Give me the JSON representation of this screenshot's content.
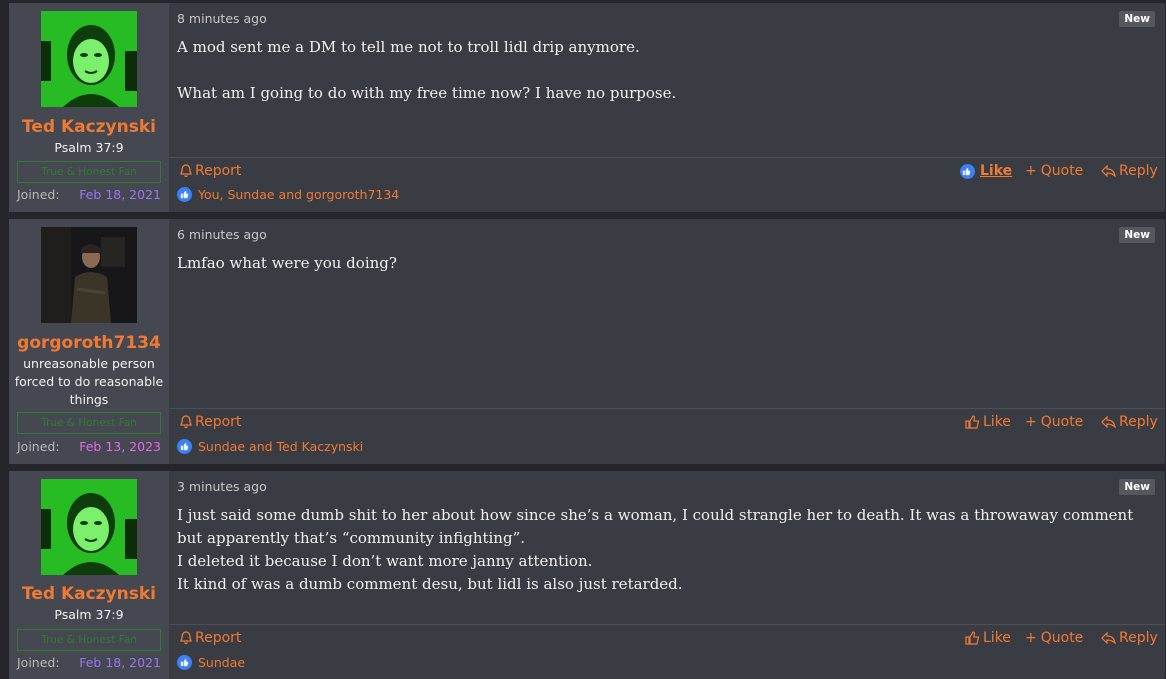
{
  "colors": {
    "accent": "#f07a32",
    "banner": "#2f7d32",
    "joined_date": "#9b74f5",
    "joined_date_alt": "#e06ce6",
    "reaction_icon": "#3b82f6"
  },
  "labels": {
    "new": "New",
    "report": "Report",
    "like": "Like",
    "quote": "Quote",
    "reply": "Reply",
    "joined": "Joined:"
  },
  "posts": [
    {
      "author": "Ted Kaczynski",
      "user_title": "Psalm 37:9",
      "banner": "True & Honest Fan",
      "joined_date": "Feb 18, 2021",
      "time": "8 minutes ago",
      "paragraphs": [
        "A mod sent me a DM to tell me not to troll lidl drip anymore.",
        "What am I going to do with my free time now? I have no purpose."
      ],
      "liked_by_you": true,
      "reactions": "You, Sundae and gorgoroth7134"
    },
    {
      "author": "gorgoroth7134",
      "user_title": "unreasonable person forced to do reasonable things",
      "banner": "True & Honest Fan",
      "joined_date": "Feb 13, 2023",
      "time": "6 minutes ago",
      "paragraphs": [
        "Lmfao what were you doing?"
      ],
      "liked_by_you": false,
      "reactions": "Sundae and Ted Kaczynski"
    },
    {
      "author": "Ted Kaczynski",
      "user_title": "Psalm 37:9",
      "banner": "True & Honest Fan",
      "joined_date": "Feb 18, 2021",
      "time": "3 minutes ago",
      "paragraphs": [
        "I just said some dumb shit to her about how since she’s a woman, I could strangle her to death. It was a throwaway comment but apparently that’s “community infighting”.",
        "I deleted it because I don’t want more janny attention.",
        "It kind of was a dumb comment desu, but lidl is also just retarded."
      ],
      "liked_by_you": false,
      "reactions": "Sundae"
    }
  ]
}
